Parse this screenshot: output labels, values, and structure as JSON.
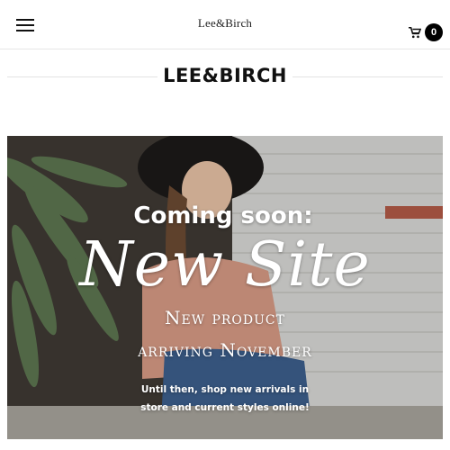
{
  "header": {
    "logo_small": "Lee&Birch",
    "menu_icon": "hamburger-menu-icon",
    "cart_icon": "shopping-cart-icon",
    "cart_count": "0"
  },
  "brand": {
    "title": "LEE&BIRCH"
  },
  "hero": {
    "line1": "Coming soon:",
    "line2": "New Site",
    "line3": "New product",
    "line4": "arriving November",
    "line5a": "Until then, shop new arrivals in",
    "line5b": "store and current styles online!"
  },
  "colors": {
    "text": "#111111",
    "border": "#e6e6e6",
    "badge_bg": "#000000",
    "hero_text": "#ffffff"
  }
}
